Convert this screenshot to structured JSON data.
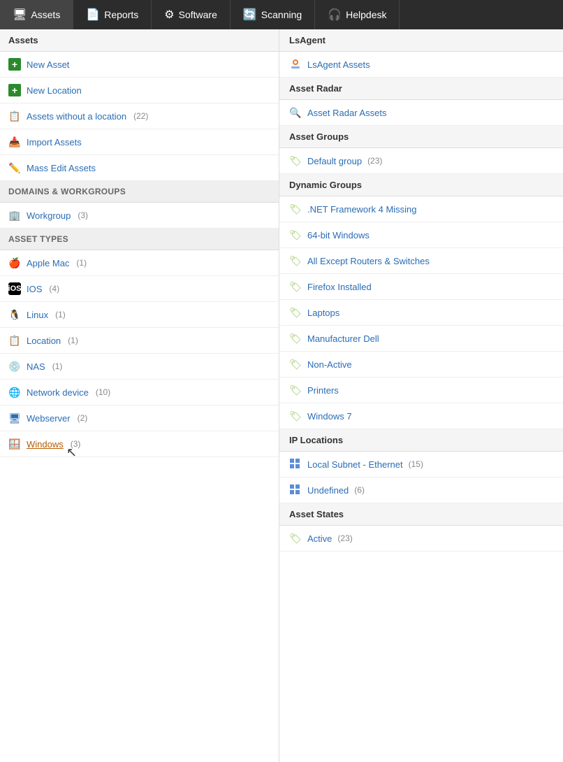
{
  "nav": {
    "items": [
      {
        "id": "assets",
        "label": "Assets",
        "icon": "🖥",
        "active": true
      },
      {
        "id": "reports",
        "label": "Reports",
        "icon": "📄"
      },
      {
        "id": "software",
        "label": "Software",
        "icon": "⚙"
      },
      {
        "id": "scanning",
        "label": "Scanning",
        "icon": "🔄"
      },
      {
        "id": "helpdesk",
        "label": "Helpdesk",
        "icon": "🎧"
      }
    ]
  },
  "left": {
    "assets_section": "Assets",
    "quick_links": [
      {
        "id": "new-asset",
        "label": "New Asset",
        "icon": "plus",
        "color": "green"
      },
      {
        "id": "new-location",
        "label": "New Location",
        "icon": "plus",
        "color": "green"
      },
      {
        "id": "assets-without-location",
        "label": "Assets without a location",
        "icon": "list",
        "count": "(22)"
      },
      {
        "id": "import-assets",
        "label": "Import Assets",
        "icon": "import"
      },
      {
        "id": "mass-edit-assets",
        "label": "Mass Edit Assets",
        "icon": "edit"
      }
    ],
    "domains_header": "Domains & Workgroups",
    "domains": [
      {
        "id": "workgroup",
        "label": "Workgroup",
        "count": "(3)"
      }
    ],
    "asset_types_header": "Asset Types",
    "asset_types": [
      {
        "id": "apple-mac",
        "label": "Apple Mac",
        "count": "(1)",
        "icon": "🍎"
      },
      {
        "id": "ios",
        "label": "IOS",
        "count": "(4)",
        "icon": "🍎"
      },
      {
        "id": "linux",
        "label": "Linux",
        "count": "(1)",
        "icon": "🐧"
      },
      {
        "id": "location",
        "label": "Location",
        "count": "(1)",
        "icon": "📋"
      },
      {
        "id": "nas",
        "label": "NAS",
        "count": "(1)",
        "icon": "💿"
      },
      {
        "id": "network-device",
        "label": "Network device",
        "count": "(10)",
        "icon": "🌐"
      },
      {
        "id": "webserver",
        "label": "Webserver",
        "count": "(2)",
        "icon": "🖥"
      },
      {
        "id": "windows",
        "label": "Windows",
        "count": "(3)",
        "icon": "🪟",
        "active": true
      }
    ]
  },
  "right": {
    "sections": [
      {
        "id": "lsagent",
        "header": "LsAgent",
        "items": [
          {
            "id": "lsagent-assets",
            "label": "LsAgent Assets",
            "icon": "lsagent"
          }
        ]
      },
      {
        "id": "asset-radar",
        "header": "Asset Radar",
        "items": [
          {
            "id": "asset-radar-assets",
            "label": "Asset Radar Assets",
            "icon": "radar"
          }
        ]
      },
      {
        "id": "asset-groups",
        "header": "Asset Groups",
        "items": [
          {
            "id": "default-group",
            "label": "Default group",
            "count": "(23)",
            "icon": "tag"
          }
        ]
      },
      {
        "id": "dynamic-groups",
        "header": "Dynamic Groups",
        "items": [
          {
            "id": "net-framework",
            "label": ".NET Framework 4 Missing",
            "icon": "tag"
          },
          {
            "id": "64bit-windows",
            "label": "64-bit Windows",
            "icon": "tag"
          },
          {
            "id": "all-except-routers",
            "label": "All Except Routers & Switches",
            "icon": "tag"
          },
          {
            "id": "firefox-installed",
            "label": "Firefox Installed",
            "icon": "tag"
          },
          {
            "id": "laptops",
            "label": "Laptops",
            "icon": "tag"
          },
          {
            "id": "manufacturer-dell",
            "label": "Manufacturer Dell",
            "icon": "tag"
          },
          {
            "id": "non-active",
            "label": "Non-Active",
            "icon": "tag"
          },
          {
            "id": "printers",
            "label": "Printers",
            "icon": "tag"
          },
          {
            "id": "windows7",
            "label": "Windows 7",
            "icon": "tag"
          }
        ]
      },
      {
        "id": "ip-locations",
        "header": "IP Locations",
        "items": [
          {
            "id": "local-subnet",
            "label": "Local Subnet - Ethernet",
            "count": "(15)",
            "icon": "grid"
          },
          {
            "id": "undefined",
            "label": "Undefined",
            "count": "(6)",
            "icon": "grid"
          }
        ]
      },
      {
        "id": "asset-states",
        "header": "Asset States",
        "items": [
          {
            "id": "active",
            "label": "Active",
            "count": "(23)",
            "icon": "tag"
          }
        ]
      }
    ]
  }
}
